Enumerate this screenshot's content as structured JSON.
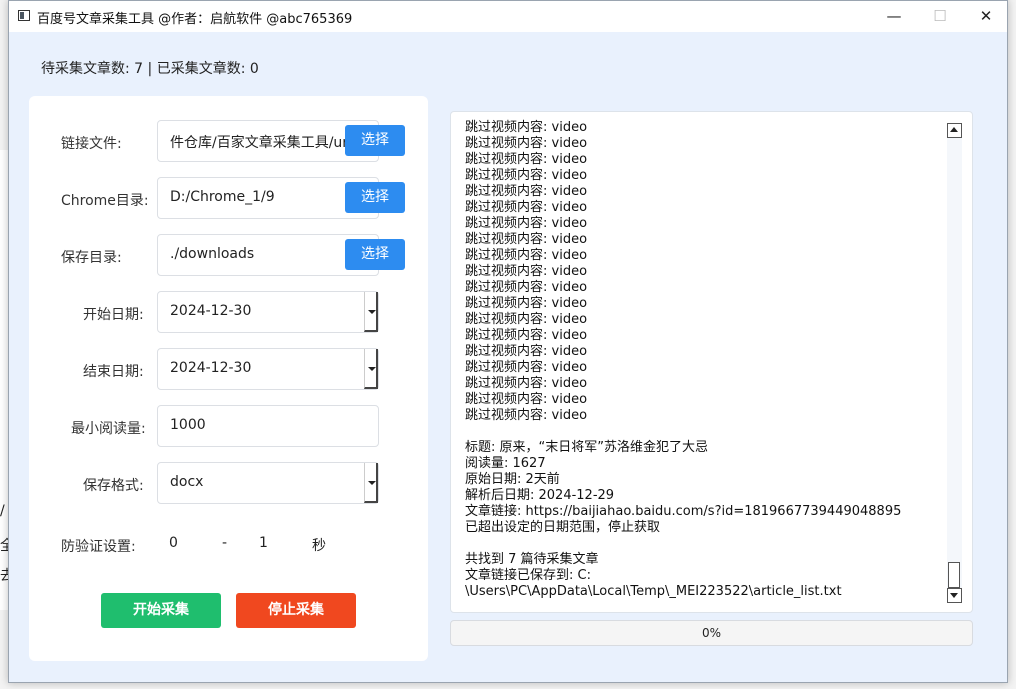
{
  "window": {
    "title": "百度号文章采集工具 @作者：启航软件 @abc765369",
    "minimize_glyph": "—",
    "maximize_glyph": "☐",
    "close_glyph": "✕"
  },
  "status_line": "待采集文章数: 7 | 已采集文章数: 0",
  "form": {
    "link_file": {
      "label": "链接文件:",
      "value": "件仓库/百家文章采集工具/urls",
      "button": "选择"
    },
    "chrome_dir": {
      "label": "Chrome目录:",
      "value": "D:/Chrome_1/9",
      "button": "选择"
    },
    "save_dir": {
      "label": "保存目录:",
      "value": "./downloads",
      "button": "选择"
    },
    "start_date": {
      "label": "开始日期:",
      "value": "2024-12-30"
    },
    "end_date": {
      "label": "结束日期:",
      "value": "2024-12-30"
    },
    "min_reads": {
      "label": "最小阅读量:",
      "value": "1000"
    },
    "save_format": {
      "label": "保存格式:",
      "value": "docx"
    },
    "anti_verify": {
      "label": "防验证设置:",
      "min": "0",
      "separator": "-",
      "max": "1",
      "unit": "秒"
    }
  },
  "buttons": {
    "start": {
      "label": "开始采集",
      "color": "#1fbe6e"
    },
    "stop": {
      "label": "停止采集",
      "color": "#f0481f"
    }
  },
  "log": {
    "lines": [
      "跳过视频内容: video",
      "跳过视频内容: video",
      "跳过视频内容: video",
      "跳过视频内容: video",
      "跳过视频内容: video",
      "跳过视频内容: video",
      "跳过视频内容: video",
      "跳过视频内容: video",
      "跳过视频内容: video",
      "跳过视频内容: video",
      "跳过视频内容: video",
      "跳过视频内容: video",
      "跳过视频内容: video",
      "跳过视频内容: video",
      "跳过视频内容: video",
      "跳过视频内容: video",
      "跳过视频内容: video",
      "跳过视频内容: video",
      "跳过视频内容: video",
      "",
      "标题: 原来，“末日将军”苏洛维金犯了大忌",
      "阅读量: 1627",
      "原始日期: 2天前",
      "解析后日期: 2024-12-29",
      "文章链接: https://baijiahao.baidu.com/s?id=1819667739449048895",
      "已超出设定的日期范围，停止获取",
      "",
      "共找到 7 篇待采集文章",
      "文章链接已保存到: C:",
      "\\Users\\PC\\AppData\\Local\\Temp\\_MEI223522\\article_list.txt"
    ]
  },
  "progress": {
    "value": 0,
    "text": "0%"
  },
  "background_glyphs": [
    "/",
    "全",
    "去"
  ],
  "colors": {
    "accent": "#2d8cf0",
    "window_bg": "#e9f1fd"
  }
}
